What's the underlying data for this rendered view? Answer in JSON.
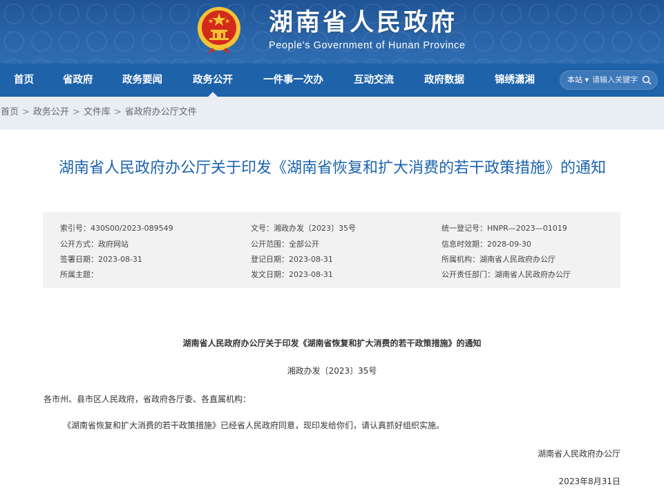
{
  "header": {
    "site_title": "湖南省人民政府",
    "site_subtitle": "People's Government of Hunan Province",
    "emblem_icon": "national-emblem-icon",
    "colors": {
      "header_bg": "#2a64a8",
      "nav_bg": "#1e62aa",
      "emblem_red": "#d42a1c",
      "emblem_gold": "#f3c434"
    }
  },
  "nav": {
    "items": [
      {
        "label": "首页"
      },
      {
        "label": "省政府"
      },
      {
        "label": "政务要闻"
      },
      {
        "label": "政务公开",
        "active": true
      },
      {
        "label": "一件事一次办"
      },
      {
        "label": "互动交流"
      },
      {
        "label": "政府数据"
      },
      {
        "label": "锦绣潇湘"
      }
    ],
    "search": {
      "scope_label": "本站 ▾",
      "placeholder": "请输入关键字",
      "icon": "search-icon"
    }
  },
  "breadcrumb": [
    "首页",
    "政务公开",
    "文件库",
    "省政府办公厅文件"
  ],
  "article": {
    "title": "湖南省人民政府办公厅关于印发《湖南省恢复和扩大消费的若干政策措施》的通知",
    "title_color": "#1c63ad",
    "meta": [
      {
        "key": "索引号：",
        "value": "430S00/2023-089549"
      },
      {
        "key": "文号：",
        "value": "湘政办发〔2023〕35号"
      },
      {
        "key": "统一登记号：",
        "value": "HNPR—2023—01019"
      },
      {
        "key": "公开方式：",
        "value": "政府网站"
      },
      {
        "key": "公开范围：",
        "value": "全部公开"
      },
      {
        "key": "信息时效期：",
        "value": "2028-09-30"
      },
      {
        "key": "签署日期：",
        "value": "2023-08-31"
      },
      {
        "key": "登记日期：",
        "value": "2023-08-31"
      },
      {
        "key": "所属机构：",
        "value": "湖南省人民政府办公厅"
      },
      {
        "key": "所属主题：",
        "value": ""
      },
      {
        "key": "发文日期：",
        "value": "2023-08-31"
      },
      {
        "key": "公开责任部门：",
        "value": "湖南省人民政府办公厅"
      }
    ],
    "body_title": "湖南省人民政府办公厅关于印发《湖南省恢复和扩大消费的若干政策措施》的通知",
    "doc_number": "湘政办发〔2023〕35号",
    "salutation": "各市州、县市区人民政府，省政府各厅委、各直属机构：",
    "paragraph": "《湖南省恢复和扩大消费的若干政策措施》已经省人民政府同意，现印发给你们，请认真抓好组织实施。",
    "signature": "湖南省人民政府办公厅",
    "date": "2023年8月31日"
  }
}
